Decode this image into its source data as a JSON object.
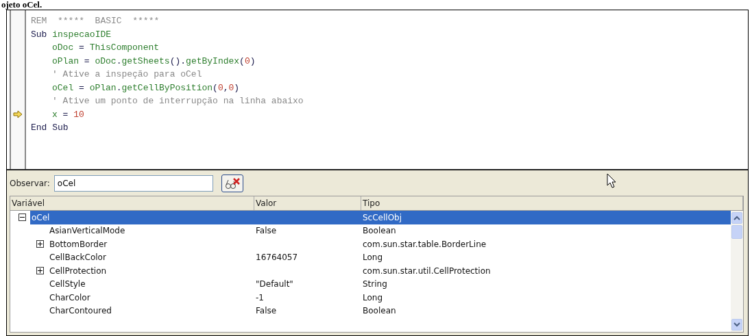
{
  "caption": "ojeto oCel.",
  "editor": {
    "lines": [
      {
        "current": false,
        "tokens": [
          {
            "kind": "comment",
            "text": "REM  *****  BASIC  *****"
          }
        ]
      },
      {
        "current": false,
        "tokens": [
          {
            "kind": "keyword",
            "text": "Sub "
          },
          {
            "kind": "ident",
            "text": "inspecaoIDE"
          }
        ],
        "children": [
          {
            "current": false,
            "tokens": [
              {
                "kind": "ident",
                "text": "oDoc"
              },
              {
                "kind": "op",
                "text": " = "
              },
              {
                "kind": "ident",
                "text": "ThisComponent"
              }
            ]
          },
          {
            "current": false,
            "tokens": [
              {
                "kind": "ident",
                "text": "oPlan"
              },
              {
                "kind": "op",
                "text": " = "
              },
              {
                "kind": "ident",
                "text": "oDoc"
              },
              {
                "kind": "op",
                "text": "."
              },
              {
                "kind": "ident",
                "text": "getSheets"
              },
              {
                "kind": "op",
                "text": "()."
              },
              {
                "kind": "ident",
                "text": "getByIndex"
              },
              {
                "kind": "op",
                "text": "("
              },
              {
                "kind": "number",
                "text": "0"
              },
              {
                "kind": "op",
                "text": ")"
              }
            ]
          },
          {
            "current": false,
            "tokens": [
              {
                "kind": "comment",
                "text": "' Ative a inspeção para oCel"
              }
            ]
          },
          {
            "current": false,
            "tokens": [
              {
                "kind": "ident",
                "text": "oCel"
              },
              {
                "kind": "op",
                "text": " = "
              },
              {
                "kind": "ident",
                "text": "oPlan"
              },
              {
                "kind": "op",
                "text": "."
              },
              {
                "kind": "ident",
                "text": "getCellByPosition"
              },
              {
                "kind": "op",
                "text": "("
              },
              {
                "kind": "number",
                "text": "0"
              },
              {
                "kind": "op",
                "text": ","
              },
              {
                "kind": "number",
                "text": "0"
              },
              {
                "kind": "op",
                "text": ")"
              }
            ]
          },
          {
            "current": false,
            "tokens": [
              {
                "kind": "comment",
                "text": "' Ative um ponto de interrupção na linha abaixo"
              }
            ]
          },
          {
            "current": true,
            "tokens": [
              {
                "kind": "ident",
                "text": "x"
              },
              {
                "kind": "op",
                "text": " = "
              },
              {
                "kind": "number",
                "text": "10"
              }
            ]
          }
        ]
      },
      {
        "current": false,
        "tokens": [
          {
            "kind": "keyword",
            "text": "End Sub"
          }
        ]
      }
    ]
  },
  "watch": {
    "label": "Observar:",
    "value": "oCel",
    "columns": [
      "Variável",
      "Valor",
      "Tipo"
    ],
    "rows": [
      {
        "name": "oCel",
        "type": "ScCellObj",
        "selected": true,
        "expanded": true,
        "children": [
          {
            "name": "AsianVerticalMode",
            "value": "False",
            "type": "Boolean",
            "selected": false
          },
          {
            "name": "BottomBorder",
            "type": "com.sun.star.table.BorderLine",
            "selected": false,
            "expanded": false
          },
          {
            "name": "CellBackColor",
            "value": "16764057",
            "type": "Long",
            "selected": false
          },
          {
            "name": "CellProtection",
            "type": "com.sun.star.util.CellProtection",
            "selected": false,
            "expanded": false
          },
          {
            "name": "CellStyle",
            "value": "\"Default\"",
            "type": "String",
            "selected": false
          },
          {
            "name": "CharColor",
            "value": "-1",
            "type": "Long",
            "selected": false
          },
          {
            "name": "CharContoured",
            "value": "False",
            "type": "Boolean",
            "selected": false
          }
        ]
      }
    ]
  }
}
